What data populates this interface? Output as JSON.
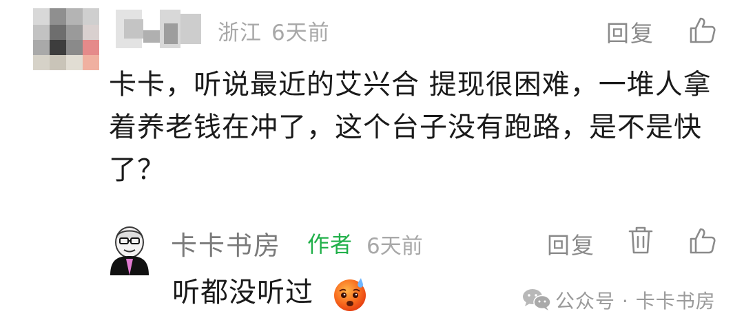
{
  "comment": {
    "location": "浙江",
    "time": "6天前",
    "reply_label": "回复",
    "text": "卡卡，听说最近的艾兴合 提现很困难，一堆人拿着养老钱在冲了，这个台子没有跑路，是不是快了？"
  },
  "reply": {
    "author": "卡卡书房",
    "author_tag": "作者",
    "time": "6天前",
    "reply_label": "回复",
    "text": "听都没听过"
  },
  "watermark": {
    "text": "公众号 · 卡卡书房"
  },
  "icons": {
    "like": "thumbs-up-icon",
    "delete": "trash-icon",
    "emoji": "sweat-face-emoji",
    "wechat": "wechat-icon"
  }
}
